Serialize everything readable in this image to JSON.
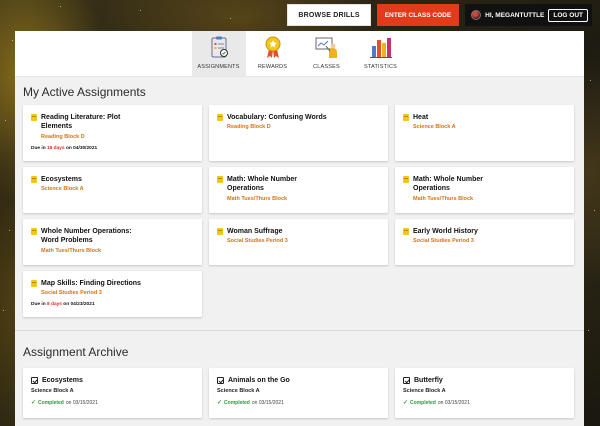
{
  "header": {
    "browse_drills": "BROWSE DRILLS",
    "enter_class_code": "ENTER CLASS CODE",
    "greeting": "HI, MEGANTUTTLE",
    "logout": "LOG OUT"
  },
  "tabs": [
    {
      "label": "ASSIGNMENTS",
      "icon": "clipboard-icon",
      "active": true
    },
    {
      "label": "REWARDS",
      "icon": "award-icon",
      "active": false
    },
    {
      "label": "CLASSES",
      "icon": "teacher-icon",
      "active": false
    },
    {
      "label": "STATISTICS",
      "icon": "bar-chart-icon",
      "active": false
    }
  ],
  "active": {
    "title": "My Active Assignments",
    "cards": [
      {
        "title_line1": "Reading Literature: Plot",
        "title_line2": "Elements",
        "class": "Reading Block D",
        "due_prefix": "Due in",
        "due_days": "15 days",
        "due_suffix": "on 04/30/2021"
      },
      {
        "title_line1": "Vocabulary: Confusing Words",
        "title_line2": "",
        "class": "Reading Block D"
      },
      {
        "title_line1": "Heat",
        "title_line2": "",
        "class": "Science Block A"
      },
      {
        "title_line1": "Ecosystems",
        "title_line2": "",
        "class": "Science Block A"
      },
      {
        "title_line1": "Math: Whole Number",
        "title_line2": "Operations",
        "class": "Math Tues/Thurs Block"
      },
      {
        "title_line1": "Math: Whole Number",
        "title_line2": "Operations",
        "class": "Math Tues/Thurs Block"
      },
      {
        "title_line1": "Whole Number Operations:",
        "title_line2": "Word Problems",
        "class": "Math Tues/Thurs Block"
      },
      {
        "title_line1": "Woman Suffrage",
        "title_line2": "",
        "class": "Social Studies Period 3"
      },
      {
        "title_line1": "Early World History",
        "title_line2": "",
        "class": "Social Studies Period 3"
      },
      {
        "title_line1": "Map Skills: Finding Directions",
        "title_line2": "",
        "class": "Social Studies Period 3",
        "due_prefix": "Due in",
        "due_days": "8 days",
        "due_suffix": "on 04/23/2021"
      }
    ]
  },
  "archive": {
    "title": "Assignment Archive",
    "cards": [
      {
        "title": "Ecosystems",
        "class": "Science Block A",
        "status": "Completed",
        "date": "on 03/15/2021"
      },
      {
        "title": "Animals on the Go",
        "class": "Science Block A",
        "status": "Completed",
        "date": "on 03/15/2021"
      },
      {
        "title": "Butterfly",
        "class": "Science Block A",
        "status": "Completed",
        "date": "on 03/15/2021"
      }
    ]
  },
  "colors": {
    "accent_red": "#e23b1c",
    "class_orange": "#d9720f",
    "due_red": "#e0261d",
    "complete_green": "#2e9b3a"
  }
}
